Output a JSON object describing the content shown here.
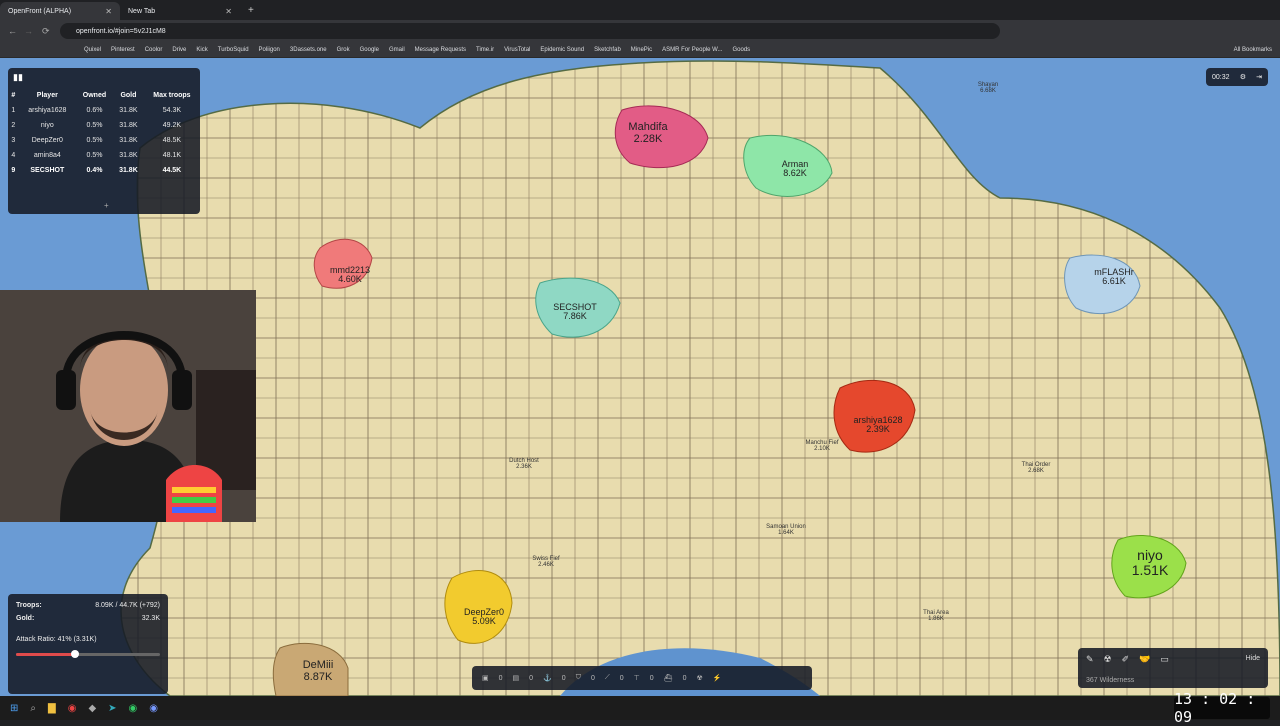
{
  "browser": {
    "tabs": [
      {
        "title": "OpenFront (ALPHA)",
        "active": true
      },
      {
        "title": "New Tab",
        "active": false
      }
    ],
    "url": "openfront.io/#join=5v2J1cM8",
    "bookmarks": [
      "Quixel",
      "Pinterest",
      "Coolor",
      "Drive",
      "Kick",
      "TurboSquid",
      "Poliigon",
      "3Dassets.one",
      "Grok",
      "Google",
      "Gmail",
      "Message Requests",
      "Time.ir",
      "VirusTotal",
      "Epidemic Sound",
      "Sketchfab",
      "MinePic",
      "ASMR For People W...",
      "Goods",
      "All Bookmarks"
    ]
  },
  "leaderboard": {
    "headers": [
      "#",
      "Player",
      "Owned",
      "Gold",
      "Max troops"
    ],
    "rows": [
      {
        "rank": "1",
        "player": "arshiya1628",
        "owned": "0.6%",
        "gold": "31.8K",
        "troops": "54.3K"
      },
      {
        "rank": "2",
        "player": "niyo",
        "owned": "0.5%",
        "gold": "31.8K",
        "troops": "49.2K"
      },
      {
        "rank": "3",
        "player": "DeepZer0",
        "owned": "0.5%",
        "gold": "31.8K",
        "troops": "48.5K"
      },
      {
        "rank": "4",
        "player": "amin8a4",
        "owned": "0.5%",
        "gold": "31.8K",
        "troops": "48.1K"
      },
      {
        "rank": "9",
        "player": "SECSHOT",
        "owned": "0.4%",
        "gold": "31.8K",
        "troops": "44.5K"
      }
    ],
    "expand": "+"
  },
  "timer": "00:32",
  "stats": {
    "troops_label": "Troops:",
    "troops_value": "8.09K / 44.7K (+792)",
    "gold_label": "Gold:",
    "gold_value": "32.3K",
    "attack_ratio": "Attack Ratio: 41% (3.31K)",
    "attack_ratio_fraction": 0.41
  },
  "build_bar": [
    "0",
    "0",
    "0",
    "0",
    "0",
    "0",
    "0"
  ],
  "tools": {
    "hide": "Hide",
    "wilderness": "367 Wilderness"
  },
  "clock": "13 : 02 : 09",
  "map_labels": [
    {
      "name": "Mahdifa",
      "value": "2.28K",
      "size": "big"
    },
    {
      "name": "Arman",
      "value": "8.62K",
      "size": "med"
    },
    {
      "name": "mmd2213",
      "value": "4.60K",
      "size": "med"
    },
    {
      "name": "SECSHOT",
      "value": "7.86K",
      "size": "med"
    },
    {
      "name": "mFLASHr",
      "value": "6.61K",
      "size": "med"
    },
    {
      "name": "arshiya1628",
      "value": "2.39K",
      "size": "med"
    },
    {
      "name": "niyo",
      "value": "1.51K",
      "size": "big"
    },
    {
      "name": "DeepZer0",
      "value": "5.09K",
      "size": "med"
    },
    {
      "name": "DeMiii",
      "value": "8.87K",
      "size": "big"
    },
    {
      "name": "Manchu Fief",
      "value": "2.10K",
      "size": "sm"
    },
    {
      "name": "Dutch Host",
      "value": "2.36K",
      "size": "sm"
    },
    {
      "name": "Swiss Fief",
      "value": "2.46K",
      "size": "sm"
    },
    {
      "name": "Thai Order",
      "value": "2.68K",
      "size": "sm"
    },
    {
      "name": "Thai Area",
      "value": "1.86K",
      "size": "sm"
    },
    {
      "name": "Samoan Union",
      "value": "1.64K",
      "size": "sm"
    },
    {
      "name": "Shayan",
      "value": "6.68K",
      "size": "sm"
    }
  ]
}
